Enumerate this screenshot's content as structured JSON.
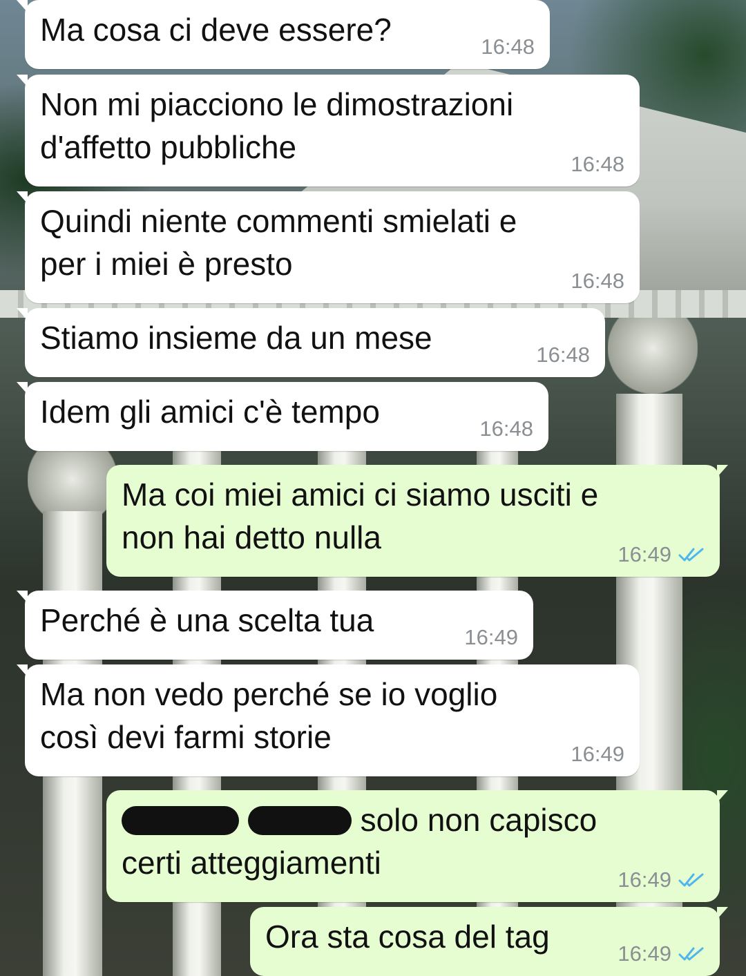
{
  "theme": {
    "incoming_bubble": "#ffffff",
    "outgoing_bubble": "#e6fdd2",
    "timestamp_color": "#8a8f93",
    "read_tick_color": "#4fb6ec"
  },
  "messages": [
    {
      "direction": "incoming",
      "text": "Ma cosa ci deve essere?",
      "time": "16:48"
    },
    {
      "direction": "incoming",
      "text": "Non mi piacciono le dimostrazioni\nd'affetto pubbliche",
      "time": "16:48"
    },
    {
      "direction": "incoming",
      "text": "Quindi niente commenti smielati e\nper i miei è presto",
      "time": "16:48"
    },
    {
      "direction": "incoming",
      "text": "Stiamo insieme da un mese",
      "time": "16:48"
    },
    {
      "direction": "incoming",
      "text": "Idem gli amici c'è tempo",
      "time": "16:48"
    },
    {
      "direction": "outgoing",
      "text": "Ma coi miei amici ci siamo usciti e\nnon hai detto nulla",
      "time": "16:49",
      "status_icon": "double-check-read-icon"
    },
    {
      "direction": "incoming",
      "text": "Perché è una scelta tua",
      "time": "16:49"
    },
    {
      "direction": "incoming",
      "text": "Ma non vedo perché se io voglio\ncosì devi farmi storie",
      "time": "16:49"
    },
    {
      "direction": "outgoing",
      "text_after_redaction": "solo non capisco",
      "text_line2": "certi atteggiamenti",
      "time": "16:49",
      "status_icon": "double-check-read-icon"
    },
    {
      "direction": "outgoing",
      "text": "Ora sta cosa del tag",
      "time": "16:49",
      "status_icon": "double-check-read-icon"
    }
  ]
}
